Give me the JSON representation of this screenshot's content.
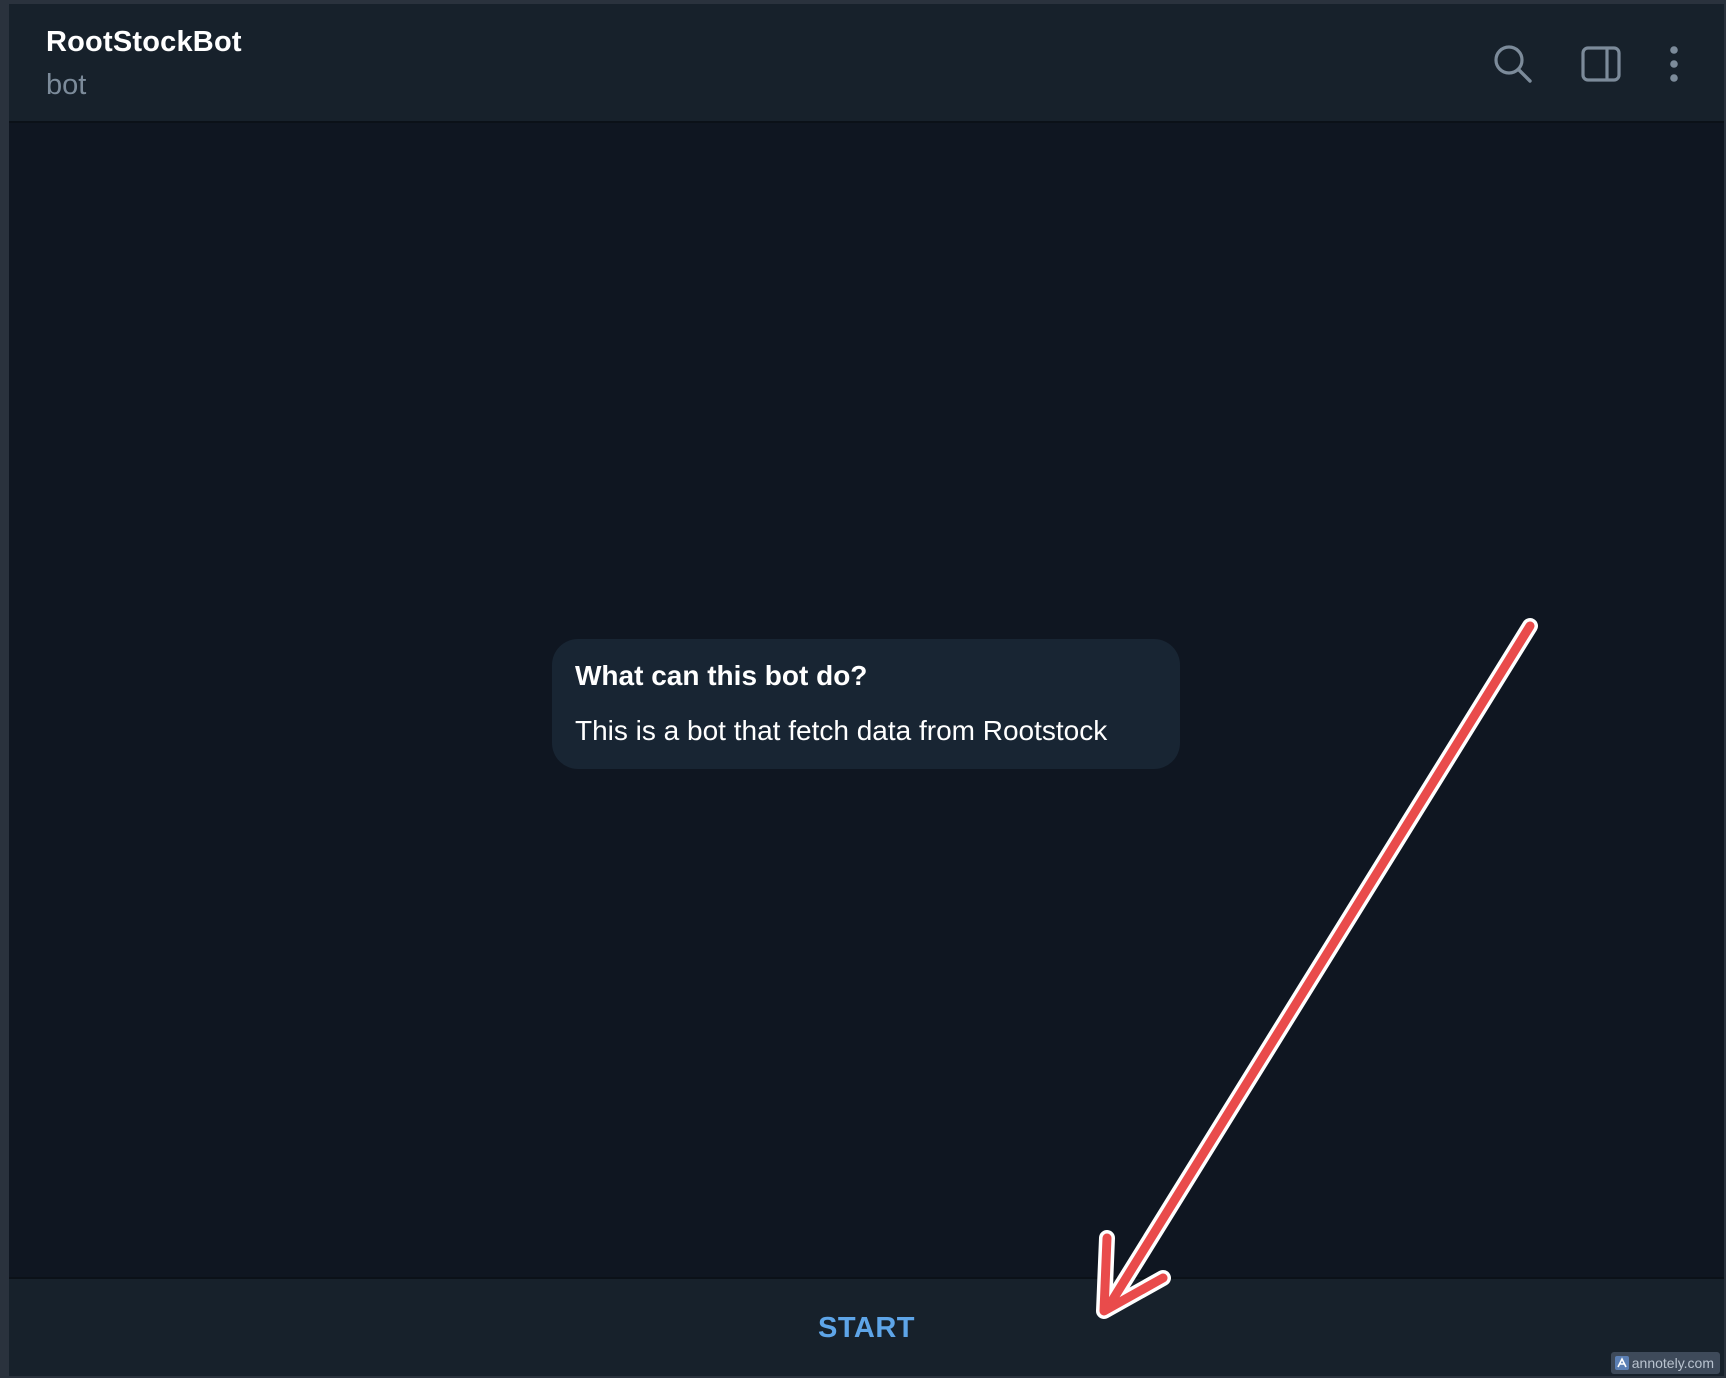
{
  "header": {
    "title": "RootStockBot",
    "subtitle": "bot",
    "icons": [
      "search-icon",
      "sidebar-toggle-icon",
      "more-vertical-icon"
    ]
  },
  "info_card": {
    "title": "What can this bot do?",
    "text": "This is a bot that fetch data from Rootstock"
  },
  "bottom": {
    "start_label": "START"
  },
  "watermark": {
    "text": "annotely.com"
  },
  "colors": {
    "background": "#0f1621",
    "header": "#17212b",
    "bubble": "#182533",
    "accent": "#5ea5e8",
    "annotation_arrow": "#e94b4b"
  }
}
